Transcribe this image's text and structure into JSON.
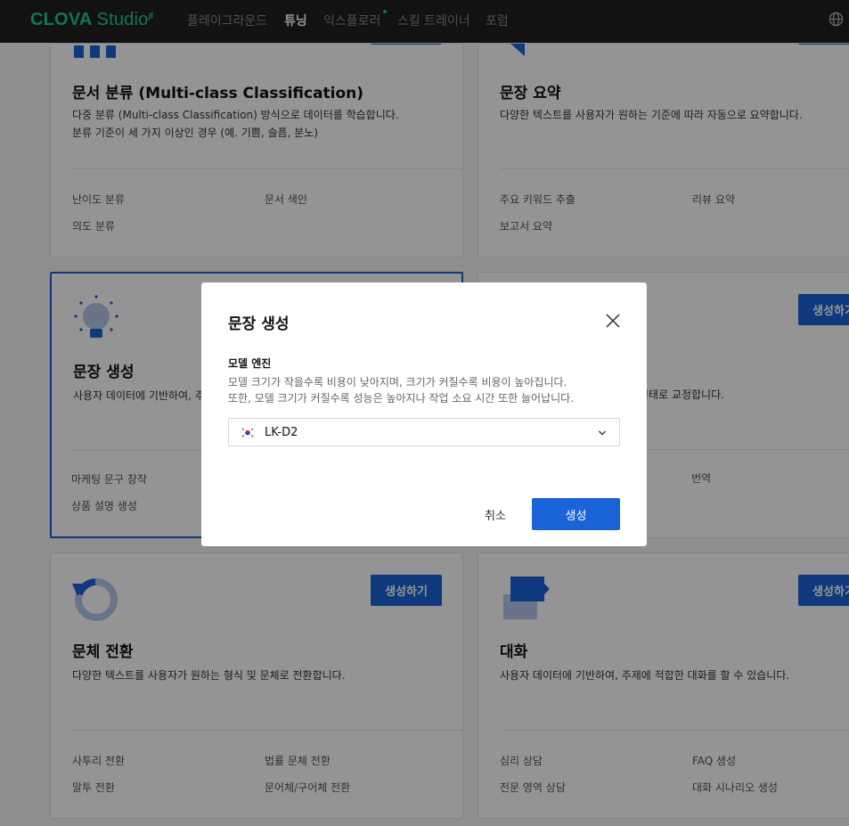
{
  "nav": {
    "logo_brand": "CLOVA",
    "logo_product": "Studio",
    "logo_mark": "β",
    "items": [
      "플레이그라운드",
      "튜닝",
      "익스플로러",
      "스킬 트레이너",
      "포럼"
    ],
    "active": "튜닝"
  },
  "cards": [
    {
      "title": "문서 분류 (Multi-class Classification)",
      "desc": [
        "다중 분류 (Multi-class Classification) 방식으로 데이터를 학습합니다.",
        "분류 기준이 세 가지 이상인 경우 (예. 기쁨, 슬픔, 분노)"
      ],
      "tags": [
        "난이도 분류",
        "문서 색인",
        "의도 분류"
      ]
    },
    {
      "title": "문장 요약",
      "desc": [
        "다양한 텍스트를 사용자가 원하는 기준에 따라 자동으로 요약합니다."
      ],
      "tags": [
        "주요 키워드 추출",
        "리뷰 요약",
        "보고서 요약"
      ]
    },
    {
      "title": "문장 생성",
      "desc": [
        "사용자 데이터에 기반하여, 주"
      ],
      "tags": [
        "마케팅 문구 창작",
        "상품 설명 생성"
      ]
    },
    {
      "title": "",
      "desc": [
        "형태로 교정합니다."
      ],
      "tags": [
        "번역"
      ],
      "button": "생성하기"
    },
    {
      "title": "문체 전환",
      "desc": [
        "다양한 텍스트를 사용자가 원하는 형식 및 문체로 전환합니다."
      ],
      "tags": [
        "사투리 전환",
        "법률 문체 전환",
        "말투 전환",
        "문어체/구어체 전환"
      ],
      "button": "생성하기"
    },
    {
      "title": "대화",
      "desc": [
        "사용자 데이터에 기반하여, 주제에 적합한 대화를 할 수 있습니다."
      ],
      "tags": [
        "심리 상담",
        "FAQ 생성",
        "전문 영역 상담",
        "대화 시나리오 생성"
      ],
      "button": "생성하기"
    }
  ],
  "modal": {
    "title": "문장 생성",
    "field_label": "모델 엔진",
    "help_lines": [
      "모델 크기가 작을수록 비용이 낮아지며, 크기가 커질수록 비용이 높아집니다.",
      "또한, 모델 크기가 커질수록 성능은 높아지나 작업 소요 시간 또한 늘어납니다."
    ],
    "engine_value": "LK-D2",
    "cancel_label": "취소",
    "create_label": "생성"
  },
  "colors": {
    "accent": "#1a63d8",
    "brand": "#20c997",
    "nav_bg": "#1f1f1f"
  }
}
